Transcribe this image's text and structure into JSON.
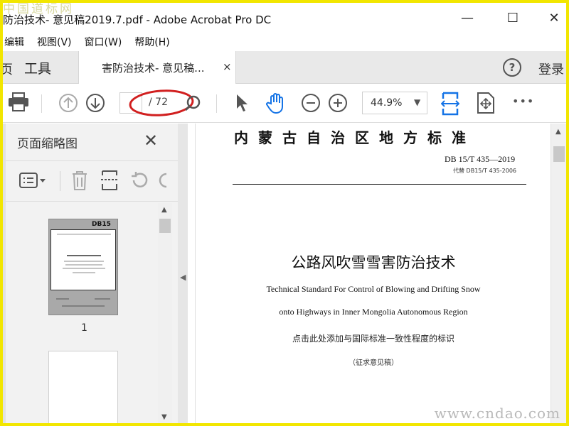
{
  "watermark": {
    "top": "中国道标网",
    "bottom": "www.cndao.com"
  },
  "window": {
    "title": "防治技术- 意见稿2019.7.pdf - Adobe Acrobat Pro DC",
    "minimize": "—",
    "maximize": "☐",
    "close": "✕"
  },
  "menu": [
    "编辑",
    "视图(V)",
    "窗口(W)",
    "帮助(H)"
  ],
  "tabs": {
    "edge": "页",
    "tools": "工具",
    "document": "害防治技术- 意见稿...",
    "close": "×",
    "help": "?",
    "login": "登录"
  },
  "toolbar": {
    "page_current": "",
    "page_total": "/ 72",
    "zoom": "44.9%",
    "zoom_caret": "▼",
    "more": "•••",
    "icons": [
      "print-icon",
      "page-up-icon",
      "page-down-icon",
      "select-arrow-icon",
      "hand-icon",
      "zoom-out-icon",
      "zoom-in-icon",
      "fit-width-icon",
      "fit-page-icon",
      "more-icon"
    ]
  },
  "panel": {
    "title": "页面缩略图",
    "close": "✕",
    "thumbs": [
      {
        "label": "1",
        "badge": "DB15"
      }
    ]
  },
  "document": {
    "header": "内蒙古自治区地方标准",
    "code": "DB 15/T 435—2019",
    "replaces": "代替 DB15/T 435-2006",
    "title": "公路风吹雪雪害防治技术",
    "title_en_1": "Technical Standard For Control of Blowing and Drifting Snow",
    "title_en_2": "onto Highways in Inner Mongolia Autonomous Region",
    "note": "点击此处添加与国际标准一致性程度的标识",
    "draft": "（征求意见稿）"
  },
  "scroll": {
    "up": "▲",
    "down": "▼",
    "left_arrow": "◀"
  },
  "colors": {
    "frame": "#f2e600",
    "highlight": "#d11f1f",
    "accent": "#1473e6"
  }
}
